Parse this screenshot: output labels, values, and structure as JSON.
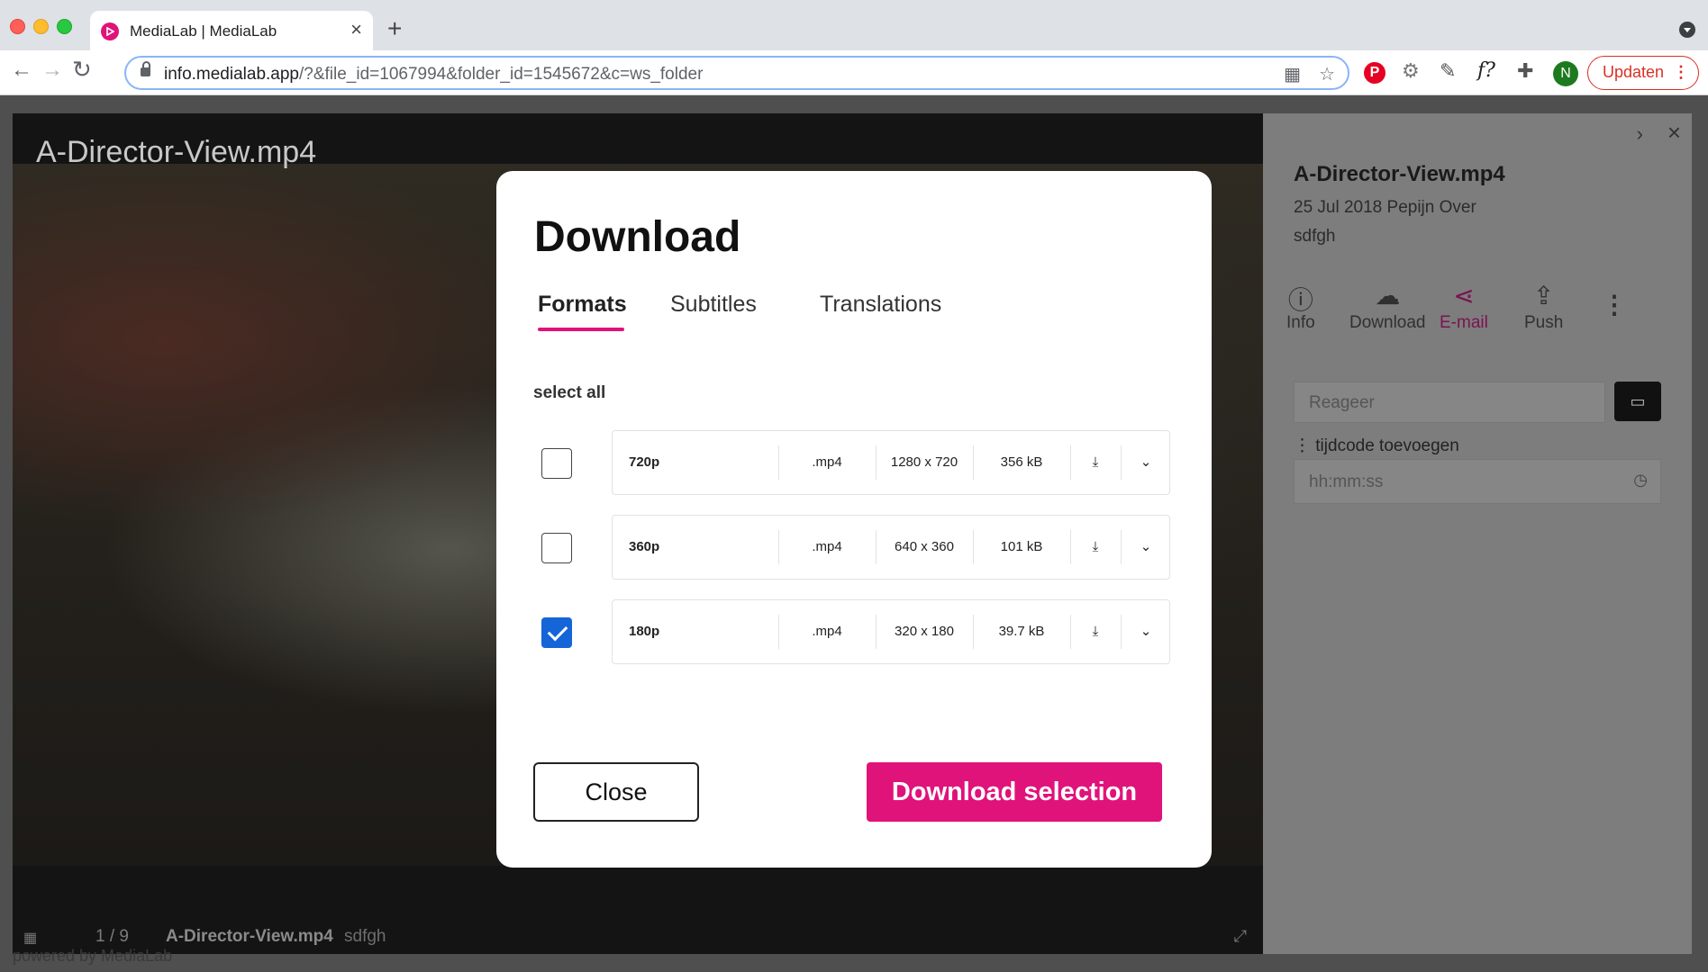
{
  "browser": {
    "tab_title": "MediaLab | MediaLab",
    "url_host": "info.medialab.app",
    "url_path": "/?&file_id=1067994&folder_id=1545672&c=ws_folder",
    "profile_initial": "N",
    "update_label": "Updaten"
  },
  "viewer": {
    "title": "A-Director-View.mp4",
    "counter": "1 / 9",
    "file_name": "A-Director-View.mp4",
    "description": "sdfgh",
    "powered_by": "powered by MediaLab"
  },
  "sidebar": {
    "title": "A-Director-View.mp4",
    "date": "25 Jul 2018",
    "author": "Pepijn Over",
    "description": "sdfgh",
    "actions": [
      {
        "label": "Info",
        "icon": "info-icon"
      },
      {
        "label": "Download",
        "icon": "cloud-download-icon"
      },
      {
        "label": "E-mail",
        "icon": "share-icon"
      },
      {
        "label": "Push",
        "icon": "upload-icon"
      }
    ],
    "comment_placeholder": "Reageer",
    "timecode_label": "tijdcode toevoegen",
    "timecode_placeholder": "hh:mm:ss"
  },
  "modal": {
    "title": "Download",
    "tabs": [
      {
        "label": "Formats",
        "active": true
      },
      {
        "label": "Subtitles",
        "active": false
      },
      {
        "label": "Translations",
        "active": false
      }
    ],
    "select_all": "select all",
    "formats": [
      {
        "name": "720p",
        "ext": ".mp4",
        "resolution": "1280 x 720",
        "size": "356 kB",
        "checked": false
      },
      {
        "name": "360p",
        "ext": ".mp4",
        "resolution": "640 x 360",
        "size": "101 kB",
        "checked": false
      },
      {
        "name": "180p",
        "ext": ".mp4",
        "resolution": "320 x 180",
        "size": "39.7 kB",
        "checked": true
      }
    ],
    "close_label": "Close",
    "download_label": "Download selection"
  },
  "colors": {
    "accent": "#e0137a",
    "checkbox_checked": "#1565d8"
  }
}
